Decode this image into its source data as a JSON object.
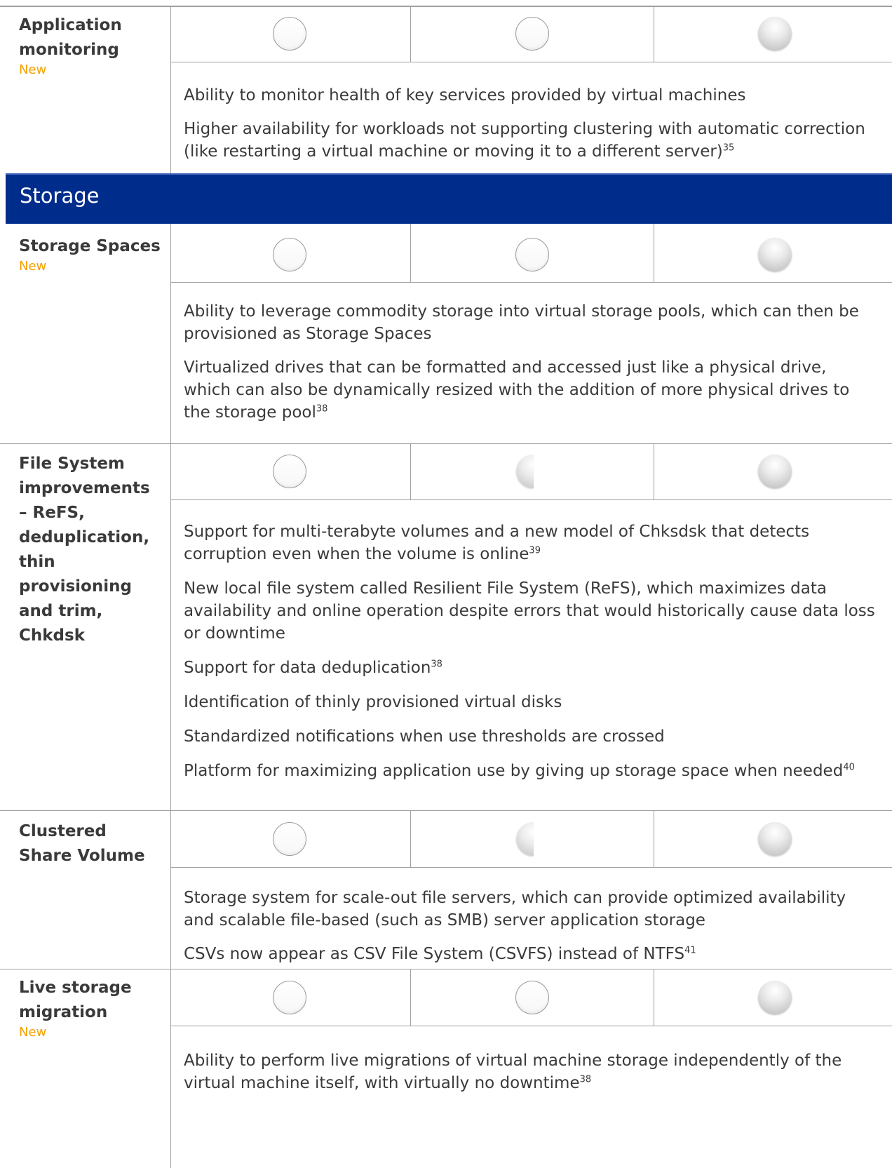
{
  "rows": {
    "app_monitoring": {
      "title": "Application monitoring",
      "new_label": "New",
      "levels": [
        "empty",
        "empty",
        "full"
      ],
      "lines": [
        "Ability to monitor health of key services provided by virtual machines",
        "Higher availability for workloads not supporting clustering with automatic correction (like restarting a virtual machine or moving it to a different server)"
      ],
      "footnotes": [
        "",
        "35"
      ]
    },
    "storage_section": {
      "title": "Storage"
    },
    "storage_spaces": {
      "title": "Storage Spaces",
      "new_label": "New",
      "levels": [
        "empty",
        "empty",
        "full"
      ],
      "lines": [
        "Ability to leverage commodity storage into virtual storage pools, which can then be provisioned as Storage Spaces",
        "Virtualized drives that can be formatted and accessed just like a physical drive, which can also be dynamically resized with the addition of more physical drives to the storage pool"
      ],
      "footnotes": [
        "",
        "38"
      ]
    },
    "file_system": {
      "title": "File System improvements – ReFS, deduplication, thin provisioning and trim, Chkdsk",
      "levels": [
        "empty",
        "half",
        "full"
      ],
      "lines": [
        "Support for multi-terabyte volumes and a new model of Chksdsk that detects corruption even when the volume is online",
        "New local file system called Resilient File System (ReFS), which maximizes data availability and online operation despite errors that would historically cause data loss or downtime",
        "Support for data deduplication",
        "Identification of thinly provisioned virtual disks",
        "Standardized notifications when use thresholds are crossed",
        "Platform for maximizing application use by giving up storage space when needed"
      ],
      "footnotes": [
        "39",
        "",
        "38",
        "",
        "",
        "40"
      ]
    },
    "csv": {
      "title": "Clustered Share Volume",
      "levels": [
        "empty",
        "half",
        "full"
      ],
      "lines": [
        "Storage system for scale-out file servers, which can provide optimized availability and scalable file-based (such as SMB) server application storage",
        "CSVs now appear as CSV File System (CSVFS) instead of NTFS"
      ],
      "footnotes": [
        "",
        "41"
      ]
    },
    "live_migration": {
      "title": "Live storage migration",
      "new_label": "New",
      "levels": [
        "empty",
        "empty",
        "full"
      ],
      "lines": [
        "Ability to perform live migrations of virtual machine storage independently of the virtual machine itself, with virtually no downtime"
      ],
      "footnotes": [
        "38"
      ]
    }
  }
}
